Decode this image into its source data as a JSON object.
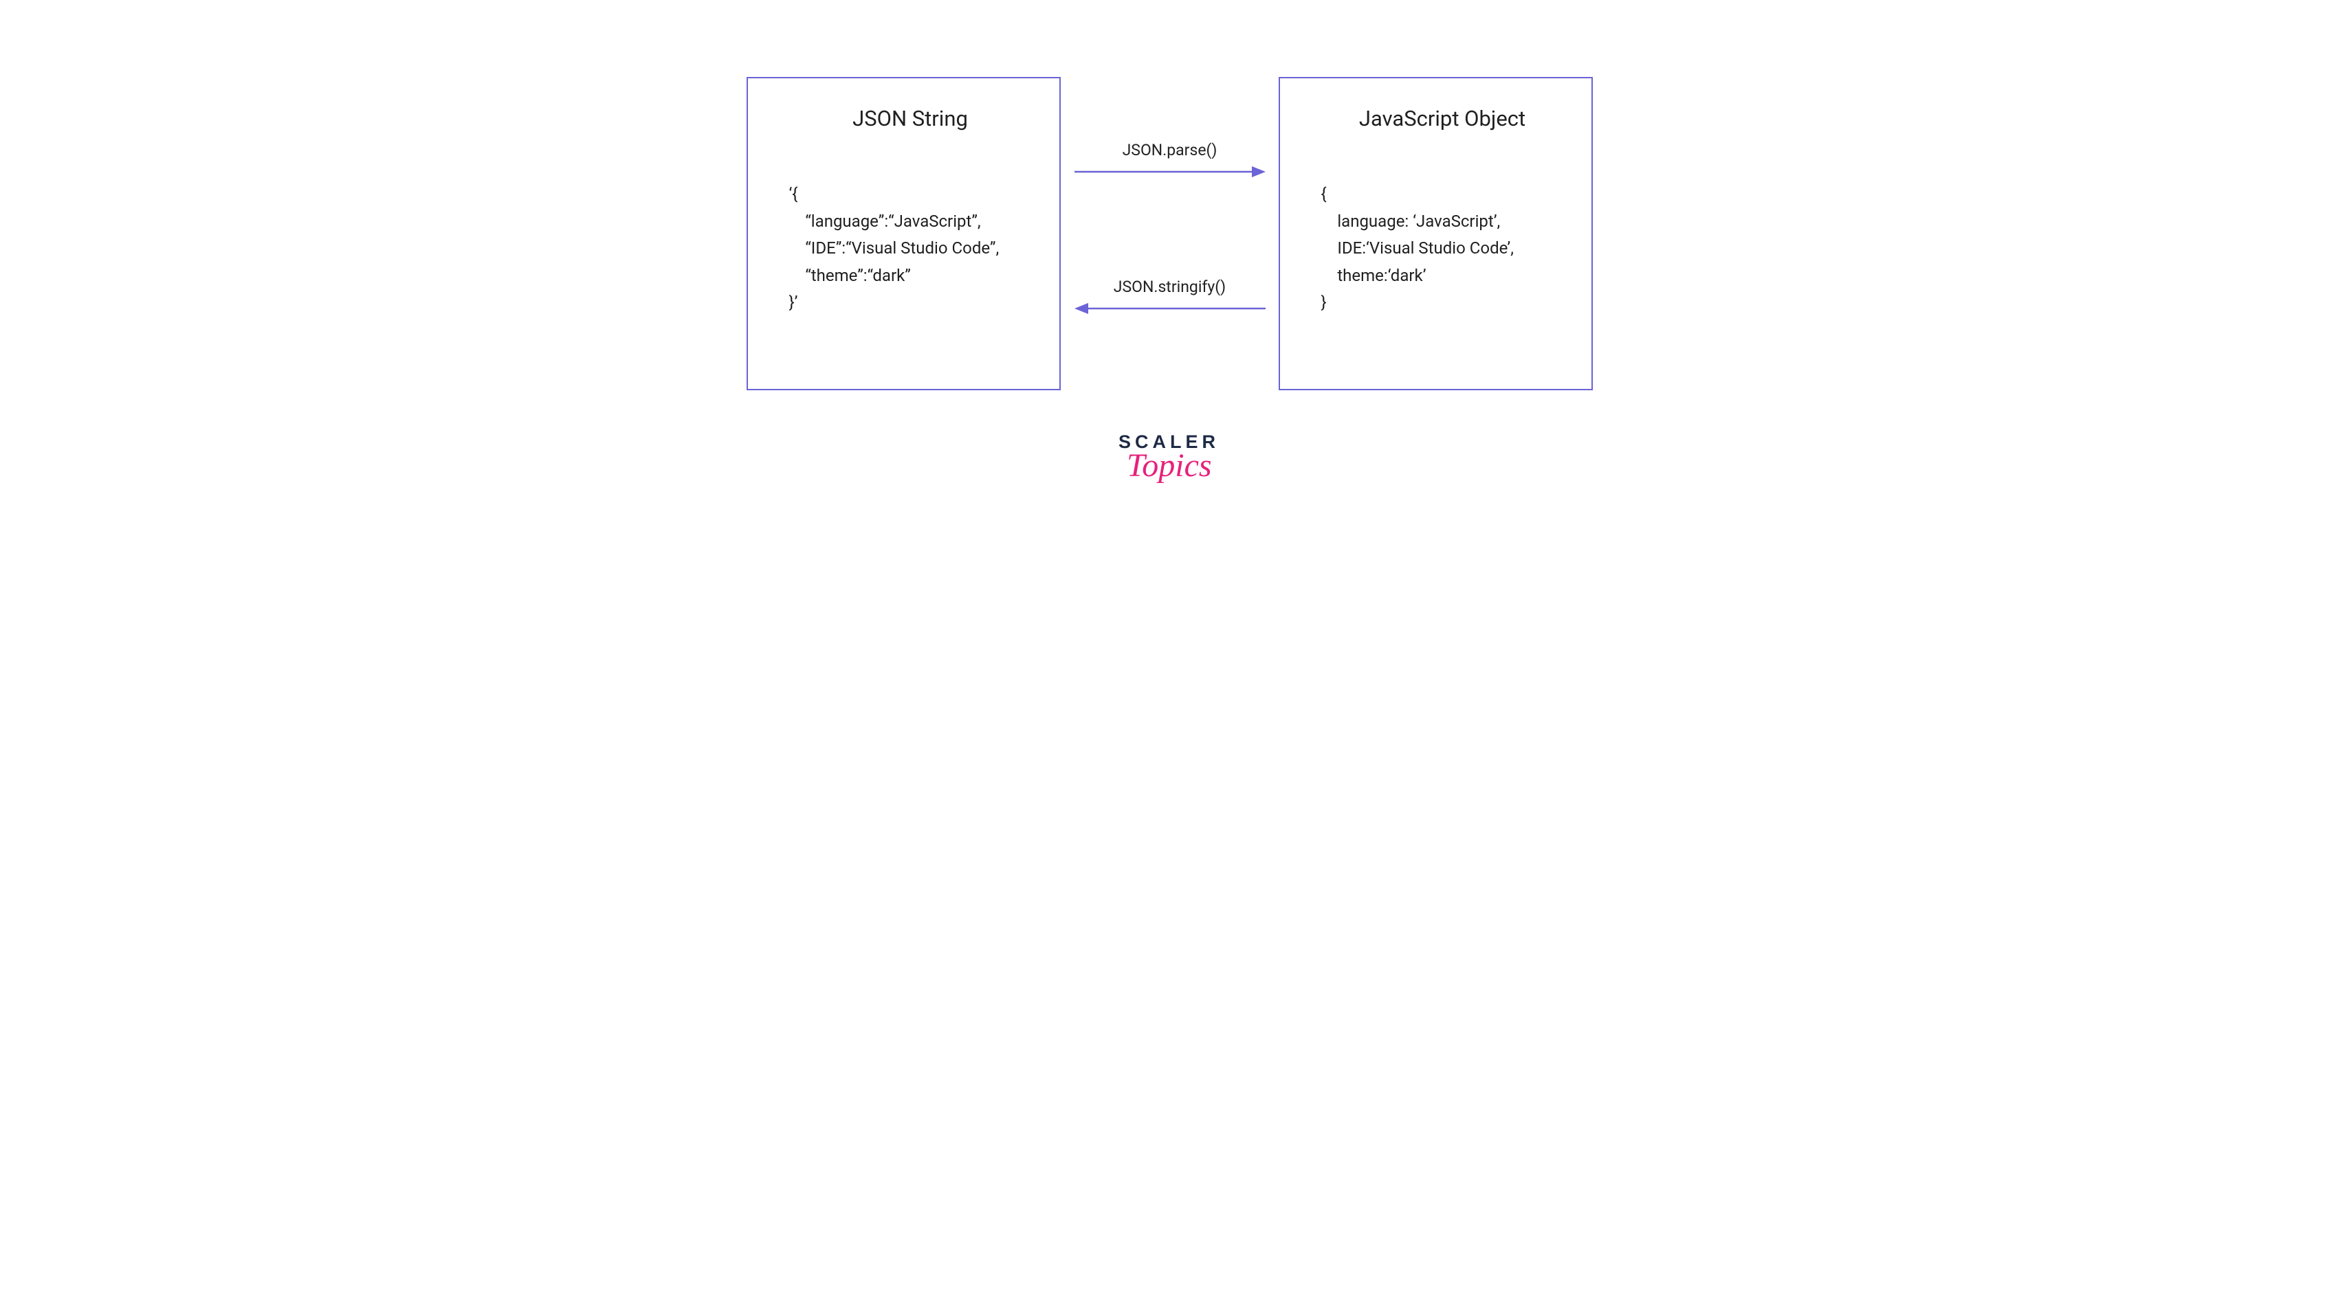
{
  "diagram": {
    "left_box": {
      "title": "JSON String",
      "code": "‘{\n    “language”:“JavaScript”,\n    “IDE”:“Visual Studio Code”,\n    “theme”:“dark”\n}’"
    },
    "right_box": {
      "title": "JavaScript Object",
      "code": "{\n    language: ‘JavaScript’,\n    IDE:‘Visual Studio Code’,\n    theme:‘dark’\n}"
    },
    "arrow_top_label": "JSON.parse()",
    "arrow_bottom_label": "JSON.stringify()",
    "colors": {
      "arrow": "#6b63d6",
      "box_border": "#6b63d6",
      "logo_dark": "#1e2a45",
      "logo_pink": "#e6227b"
    }
  },
  "logo": {
    "line1": "SCALER",
    "line2": "Topics"
  }
}
